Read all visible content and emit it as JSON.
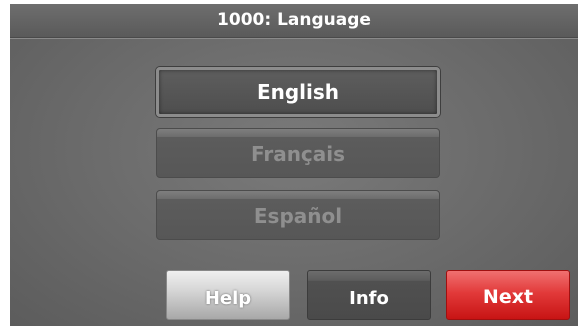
{
  "header": {
    "title": "1000: Language"
  },
  "languages": [
    {
      "label": "English",
      "selected": true
    },
    {
      "label": "Français",
      "selected": false
    },
    {
      "label": "Español",
      "selected": false
    }
  ],
  "footer": {
    "help_label": "Help",
    "info_label": "Info",
    "next_label": "Next"
  },
  "colors": {
    "background": "#6a6a6a",
    "next_accent": "#e23a3a",
    "help_accent": "#d6d6d6"
  }
}
